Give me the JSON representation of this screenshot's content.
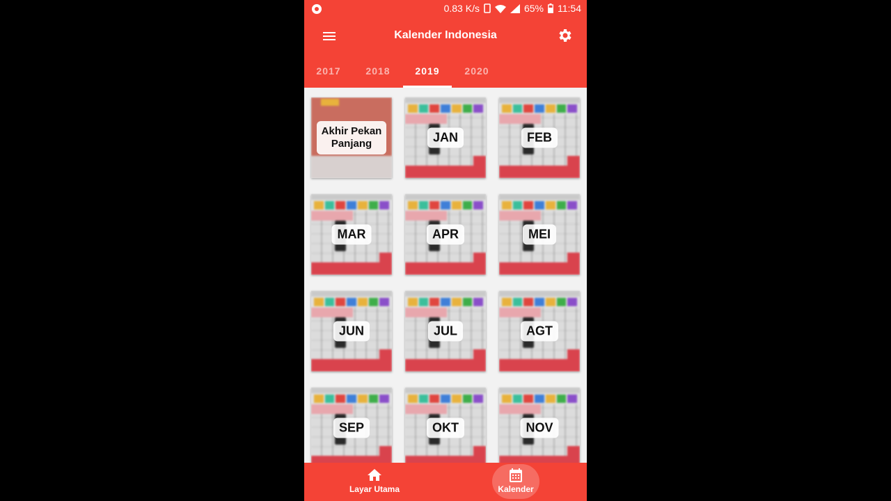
{
  "status_bar": {
    "speed": "0.83 K/s",
    "battery": "65%",
    "time": "11:54"
  },
  "app_bar": {
    "title": "Kalender Indonesia",
    "menu_icon": "hamburger-menu-icon",
    "settings_icon": "gear-icon"
  },
  "tabs": [
    {
      "label": "2017",
      "active": false
    },
    {
      "label": "2018",
      "active": false
    },
    {
      "label": "2019",
      "active": true
    },
    {
      "label": "2020",
      "active": false
    }
  ],
  "cards": [
    {
      "label": "Akhir Pekan Panjang"
    },
    {
      "label": "JAN"
    },
    {
      "label": "FEB"
    },
    {
      "label": "MAR"
    },
    {
      "label": "APR"
    },
    {
      "label": "MEI"
    },
    {
      "label": "JUN"
    },
    {
      "label": "JUL"
    },
    {
      "label": "AGT"
    },
    {
      "label": "SEP"
    },
    {
      "label": "OKT"
    },
    {
      "label": "NOV"
    }
  ],
  "bottom_nav": [
    {
      "label": "Layar Utama",
      "icon": "home-icon",
      "active": false
    },
    {
      "label": "Kalender",
      "icon": "calendar-icon",
      "active": true
    }
  ],
  "colors": {
    "primary": "#f44336",
    "day_colors": [
      "#e8b23c",
      "#3bbf9b",
      "#e0463f",
      "#3f7fd8",
      "#e8b23c",
      "#3fae4a",
      "#8a4fc9"
    ]
  }
}
